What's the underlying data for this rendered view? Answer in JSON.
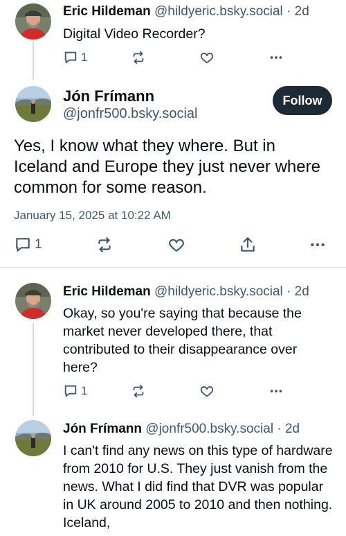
{
  "parent_post": {
    "author_name": "Eric Hildeman",
    "author_handle": "@hildyeric.bsky.social",
    "separator": "·",
    "age": "2d",
    "text": "Digital Video Recorder?",
    "reply_count": "1"
  },
  "main_post": {
    "author_name": "Jón Frímann",
    "author_handle": "@jonfr500.bsky.social",
    "follow_label": "Follow",
    "text": "Yes, I know what they where. But in Iceland and Europe they just never where common for some reason.",
    "timestamp": "January 15, 2025 at 10:22 AM",
    "reply_count": "1"
  },
  "reply_1": {
    "author_name": "Eric Hildeman",
    "author_handle": "@hildyeric.bsky.social",
    "separator": "·",
    "age": "2d",
    "text": "Okay, so you're saying that because the market never developed there, that contributed to their disappearance over here?",
    "reply_count": "1"
  },
  "reply_2": {
    "author_name": "Jón Frímann",
    "author_handle": "@jonfr500.bsky.social",
    "separator": "·",
    "age": "2d",
    "text": "I can't find any news on this type of hardware from 2010 for U.S. They just vanish from the news. What I did find that DVR was popular in UK around 2005 to 2010 and then nothing. Iceland,"
  },
  "icons": [
    "reply-icon",
    "repost-icon",
    "like-icon",
    "more-icon",
    "share-icon"
  ],
  "colors": {
    "muted": "#42576c",
    "follow_bg": "#1e2936",
    "thread_line": "#d4dbe2"
  }
}
